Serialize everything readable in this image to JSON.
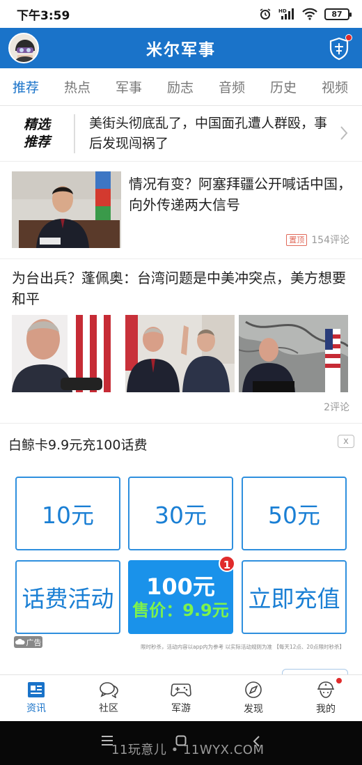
{
  "status_bar": {
    "time": "下午3:59",
    "battery": "87",
    "icons": [
      "alarm-icon",
      "hd-signal-icon",
      "wifi-icon",
      "battery-icon"
    ]
  },
  "header": {
    "title": "米尔军事",
    "accent": "#1a73c9",
    "avatar_icon": "avatar-icon",
    "shield_icon": "shield-icon"
  },
  "tabs": [
    {
      "label": "推荐",
      "active": true
    },
    {
      "label": "热点"
    },
    {
      "label": "军事"
    },
    {
      "label": "励志"
    },
    {
      "label": "音频"
    },
    {
      "label": "历史"
    },
    {
      "label": "视频"
    }
  ],
  "featured": {
    "badge_line1": "精选",
    "badge_line2": "推荐",
    "title": "美街头彻底乱了，中国面孔遭人群殴，事后发现闯祸了"
  },
  "article1": {
    "title": "情况有变？阿塞拜疆公开喊话中国，向外传递两大信号",
    "pin_tag": "置顶",
    "comments": "154评论"
  },
  "article2": {
    "title": "为台出兵？蓬佩奥：台湾问题是中美冲突点，美方想要和平",
    "comments": "2评论"
  },
  "ad": {
    "title": "白鲸卡9.9元充100话费",
    "close": "x",
    "options": [
      "10元",
      "30元",
      "50元"
    ],
    "activity": "话费活动",
    "promo_main": "100元",
    "promo_sub": "售价：9.9元",
    "badge": "1",
    "recharge": "立即充值",
    "ad_label": "广告",
    "disclaimer": "限时秒杀，活动内容以app内为参考 以实际活动规则为准 【每天12点、20点限时秒杀】"
  },
  "bottom_nav": [
    {
      "label": "资讯",
      "icon": "news-icon",
      "active": true
    },
    {
      "label": "社区",
      "icon": "chat-icon"
    },
    {
      "label": "军游",
      "icon": "gamepad-icon"
    },
    {
      "label": "发现",
      "icon": "compass-icon"
    },
    {
      "label": "我的",
      "icon": "profile-icon"
    }
  ],
  "watermark": "11玩意儿 • 11WYX.COM"
}
